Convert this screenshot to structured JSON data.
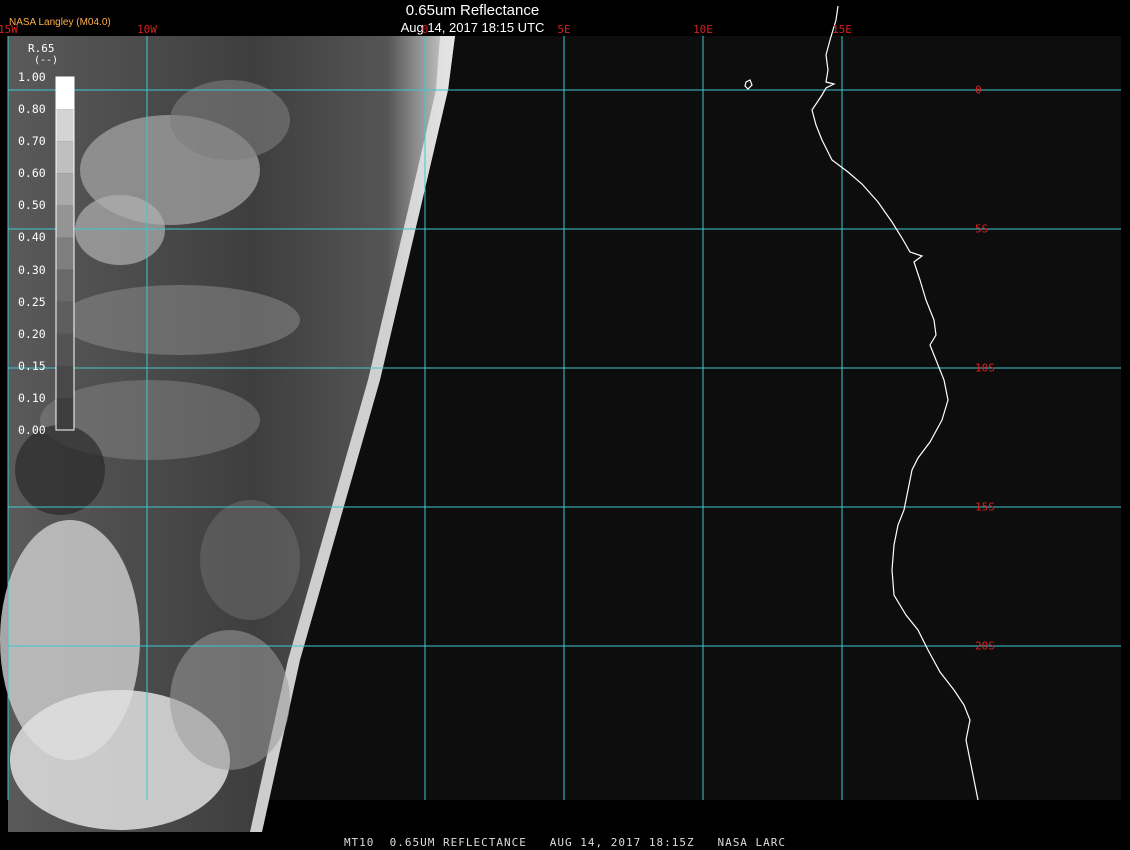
{
  "header": {
    "title": "0.65um Reflectance",
    "subtitle": "Aug 14, 2017 18:15 UTC",
    "brand": "NASA Langley (M04.0)"
  },
  "footer": {
    "text": "MT10  0.65UM REFLECTANCE   AUG 14, 2017 18:15Z   NASA LARC"
  },
  "grid": {
    "color": "#3fc8d0",
    "label_color": "#d42020",
    "longitudes": [
      {
        "value": -15,
        "label": "15W"
      },
      {
        "value": -10,
        "label": "10W"
      },
      {
        "value": 0,
        "label": "0"
      },
      {
        "value": 5,
        "label": "5E"
      },
      {
        "value": 10,
        "label": "10E"
      },
      {
        "value": 15,
        "label": "15E"
      }
    ],
    "latitudes": [
      {
        "value": 0,
        "label": "0"
      },
      {
        "value": -5,
        "label": "5S"
      },
      {
        "value": -10,
        "label": "10S"
      },
      {
        "value": -15,
        "label": "15S"
      },
      {
        "value": -20,
        "label": "20S"
      }
    ]
  },
  "legend": {
    "title": "R.65",
    "units": "(--)",
    "ticks": [
      "1.00",
      "0.80",
      "0.70",
      "0.60",
      "0.50",
      "0.40",
      "0.30",
      "0.25",
      "0.20",
      "0.15",
      "0.10",
      "0.00"
    ],
    "tick_values": [
      1.0,
      0.8,
      0.7,
      0.6,
      0.5,
      0.4,
      0.3,
      0.25,
      0.2,
      0.15,
      0.1,
      0.0
    ]
  },
  "coastline_color": "#ffffff",
  "imagery": {
    "colormap": "grayscale",
    "night_color": "#0d0d0d"
  }
}
